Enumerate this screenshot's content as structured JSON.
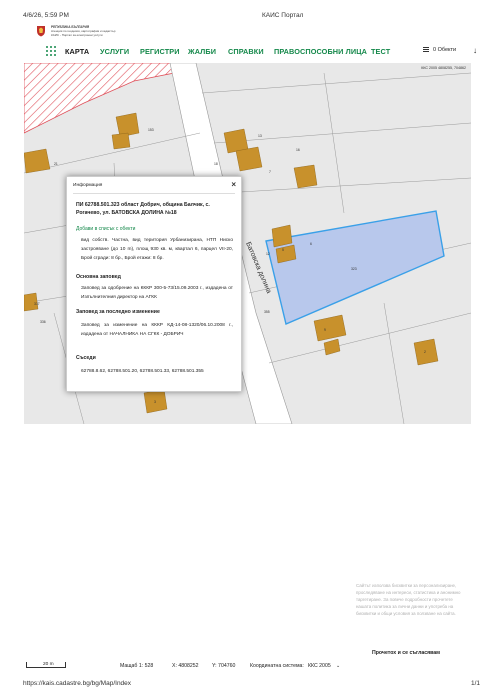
{
  "print_header": {
    "datetime": "4/6/26, 5:59 PM",
    "title": "КАИС Портал"
  },
  "print_footer": {
    "url": "https://kais.cadastre.bg/bg/Map/Index",
    "page": "1/1"
  },
  "agency": {
    "line1": "РЕПУБЛИКА БЪЛГАРИЯ",
    "line2": "Агенция по геодезия, картография и кадастър",
    "line3": "КАИС - Портал за електронни услуги"
  },
  "nav": {
    "items": [
      "КАРТА",
      "УСЛУГИ",
      "РЕГИСТРИ",
      "ЖАЛБИ",
      "СПРАВКИ",
      "ПРАВОСПОСОБНИ ЛИЦА",
      "ТЕСТ"
    ],
    "objects_label": "0 Обекти"
  },
  "map": {
    "coord_caption": "ККС 2005 4808255, 704862",
    "street_name": "Батовска долина",
    "parcel_labels": [
      "153",
      "21",
      "16",
      "18",
      "323",
      "13",
      "12",
      "355",
      "336",
      "337",
      "7",
      "6",
      "5",
      "9",
      "2",
      "3"
    ],
    "colors": {
      "building": "#c8912c",
      "highlight": "#b8c8ec",
      "highlight_border": "#3aa0e8",
      "hatch": "#e0505a"
    }
  },
  "popup": {
    "title": "Информация",
    "close": "×",
    "heading": "ПИ 62788.501.323 област Добрич, община Балчик, с. Рогачево, ул. БАТОВСКА ДОЛИНА №18",
    "add_link": "Добави в списък с обекти",
    "description": "вид собств. Частна, вид територия Урбанизирана, НТП Ниско застрояване (до 10 m), площ 930 кв. м, квартал 6, парцел VII-20, Брой сгради: 8 бр., Брой етажи: 8 бр.",
    "basic_order_heading": "Основна заповед",
    "basic_order_text": "Заповед за одобрение на КККР 300-5-73/15.09.2003 г., издадена от Изпълнителния директор на АГКК",
    "last_change_heading": "Заповед за последно изменение",
    "last_change_text": "Заповед за изменение на КККР КД-14-08-1320/06.10.2008 г., издадена от НАЧАЛНИКА НА СГКК - ДОБРИЧ",
    "neighbours_heading": "Съседи",
    "neighbours_text": "62788.8.62, 62788.501.20, 62788.501.33, 62788.501.355"
  },
  "status_bar": {
    "scale_label": "20 m",
    "scale_text": "Мащаб 1:  528",
    "x_label": "X:  4808252",
    "y_label": "Y:  704760",
    "system_label": "Координатна система:",
    "system_value": "ККС 2005",
    "caret": "⌄"
  },
  "cookie": {
    "text": "Сайтът използва бисквитки за персонализиране, проследяване на интереси, статистика и анонимно таргетиране. За повече подробности прочетете нашата политика за лични данни и употреба на бисквитки и общи условия за ползване на сайта.",
    "button": "Прочетох и се съгласявам"
  }
}
